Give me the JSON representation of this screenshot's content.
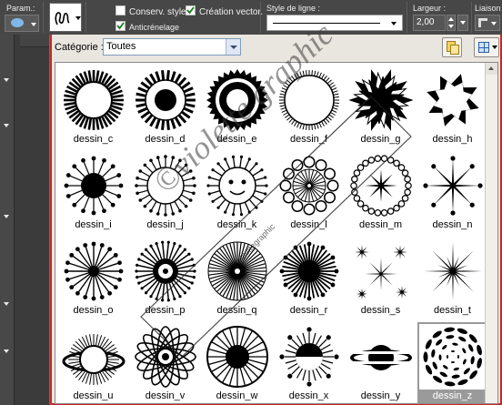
{
  "toolbar": {
    "param_label": "Param.:",
    "conserv_style": "Conserv. style",
    "creation_vector": "Création vector.",
    "anticrenelage": "Anticrénelage",
    "line_style_label": "Style de ligne :",
    "width_label": "Largeur :",
    "width_value": "2,00",
    "liaison_label": "Liaison :"
  },
  "dialog": {
    "category_label": "Catégorie :",
    "category_value": "Toutes"
  },
  "watermark": {
    "main": "©violette graphic",
    "small": "violettegraphic"
  },
  "shapes": [
    {
      "label": "dessin_c",
      "kind": "ray-ring"
    },
    {
      "label": "dessin_d",
      "kind": "dot-sun"
    },
    {
      "label": "dessin_e",
      "kind": "gear"
    },
    {
      "label": "dessin_f",
      "kind": "thin-ring"
    },
    {
      "label": "dessin_g",
      "kind": "spiky"
    },
    {
      "label": "dessin_h",
      "kind": "star-burst"
    },
    {
      "label": "dessin_i",
      "kind": "pin-sun"
    },
    {
      "label": "dessin_j",
      "kind": "dot-ring"
    },
    {
      "label": "dessin_k",
      "kind": "face-sun"
    },
    {
      "label": "dessin_l",
      "kind": "beads"
    },
    {
      "label": "dessin_m",
      "kind": "bead-ring-star"
    },
    {
      "label": "dessin_n",
      "kind": "star8"
    },
    {
      "label": "dessin_o",
      "kind": "pin-burst"
    },
    {
      "label": "dessin_p",
      "kind": "target"
    },
    {
      "label": "dessin_q",
      "kind": "dense-burst"
    },
    {
      "label": "dessin_r",
      "kind": "dark-burst"
    },
    {
      "label": "dessin_s",
      "kind": "sparkles"
    },
    {
      "label": "dessin_t",
      "kind": "sparkle"
    },
    {
      "label": "dessin_u",
      "kind": "saturn"
    },
    {
      "label": "dessin_v",
      "kind": "flower"
    },
    {
      "label": "dessin_w",
      "kind": "spoke-ring"
    },
    {
      "label": "dessin_x",
      "kind": "split-sun"
    },
    {
      "label": "dessin_y",
      "kind": "planet"
    },
    {
      "label": "dessin_z",
      "kind": "swirl"
    }
  ],
  "selected_index": 23
}
